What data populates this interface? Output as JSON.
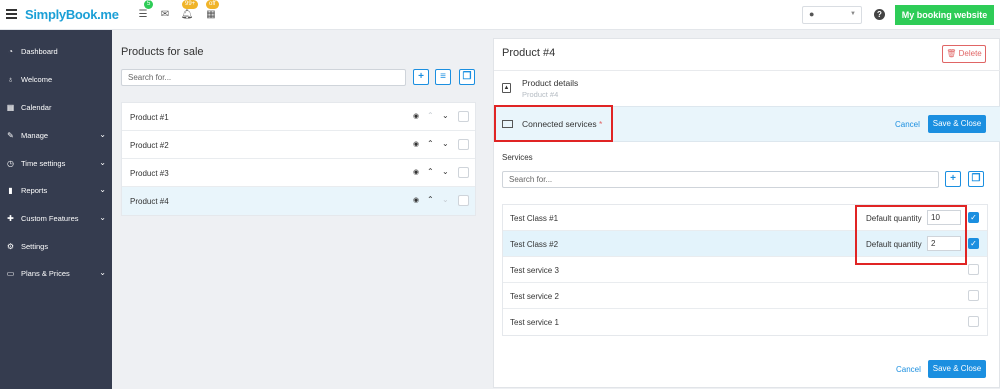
{
  "header": {
    "logo": "SimplyBook.me",
    "notifications": [
      {
        "icon": "list-icon",
        "badge": "5",
        "badge_color": "#2ecc57"
      },
      {
        "icon": "envelope-icon",
        "badge": "",
        "badge_color": ""
      },
      {
        "icon": "bell-icon",
        "badge": "99+",
        "badge_color": "#f0b429"
      },
      {
        "icon": "calendar-icon",
        "badge": "off",
        "badge_color": "#f0b429"
      }
    ],
    "booking_button": "My booking website"
  },
  "sidebar": {
    "items": [
      {
        "label": "Dashboard",
        "icon": "dashboard-icon",
        "has_chevron": false
      },
      {
        "label": "Welcome",
        "icon": "lightbulb-icon",
        "has_chevron": false
      },
      {
        "label": "Calendar",
        "icon": "calendar-icon",
        "has_chevron": false
      },
      {
        "label": "Manage",
        "icon": "pencil-icon",
        "has_chevron": true
      },
      {
        "label": "Time settings",
        "icon": "clock-icon",
        "has_chevron": true
      },
      {
        "label": "Reports",
        "icon": "bar-chart-icon",
        "has_chevron": true
      },
      {
        "label": "Custom Features",
        "icon": "puzzle-icon",
        "has_chevron": true
      },
      {
        "label": "Settings",
        "icon": "gears-icon",
        "has_chevron": false
      },
      {
        "label": "Plans & Prices",
        "icon": "money-icon",
        "has_chevron": true
      }
    ]
  },
  "products": {
    "title": "Products for sale",
    "search_placeholder": "Search for...",
    "items": [
      {
        "name": "Product #1"
      },
      {
        "name": "Product #2"
      },
      {
        "name": "Product #3"
      },
      {
        "name": "Product #4"
      }
    ]
  },
  "detail": {
    "title": "Product #4",
    "delete_label": "Delete",
    "product_details_label": "Product details",
    "product_details_sub": "Product #4",
    "connected_services_label": "Connected services",
    "connected_services_star": "*",
    "cancel_label": "Cancel",
    "save_label": "Save & Close",
    "services_heading": "Services",
    "services_search_placeholder": "Search for...",
    "services": [
      {
        "name": "Test Class #1",
        "qty_label": "Default quantity",
        "qty": "10",
        "checked": true
      },
      {
        "name": "Test Class #2",
        "qty_label": "Default quantity",
        "qty": "2",
        "checked": true
      },
      {
        "name": "Test service 3",
        "qty_label": "",
        "qty": "",
        "checked": false
      },
      {
        "name": "Test service 2",
        "qty_label": "",
        "qty": "",
        "checked": false
      },
      {
        "name": "Test service 1",
        "qty_label": "",
        "qty": "",
        "checked": false
      }
    ]
  },
  "colors": {
    "accent": "#1b8fe0",
    "sidebar": "#353c4f",
    "highlight": "#e02424",
    "success": "#2ecc57"
  }
}
